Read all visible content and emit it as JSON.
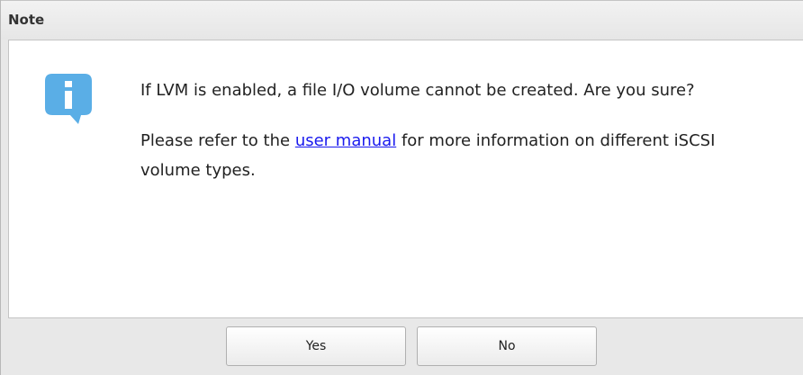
{
  "dialog": {
    "title": "Note",
    "message": {
      "line1": "If LVM is enabled, a file I/O volume cannot be created. Are you sure?",
      "line2_before": "Please refer to the ",
      "link_text": "user manual",
      "line2_after": " for more information on different iSCSI volume types."
    },
    "buttons": {
      "yes_label": "Yes",
      "no_label": "No"
    },
    "icon": "info-icon",
    "colors": {
      "icon_blue": "#5aaee6",
      "link": "#1a1aee"
    }
  }
}
